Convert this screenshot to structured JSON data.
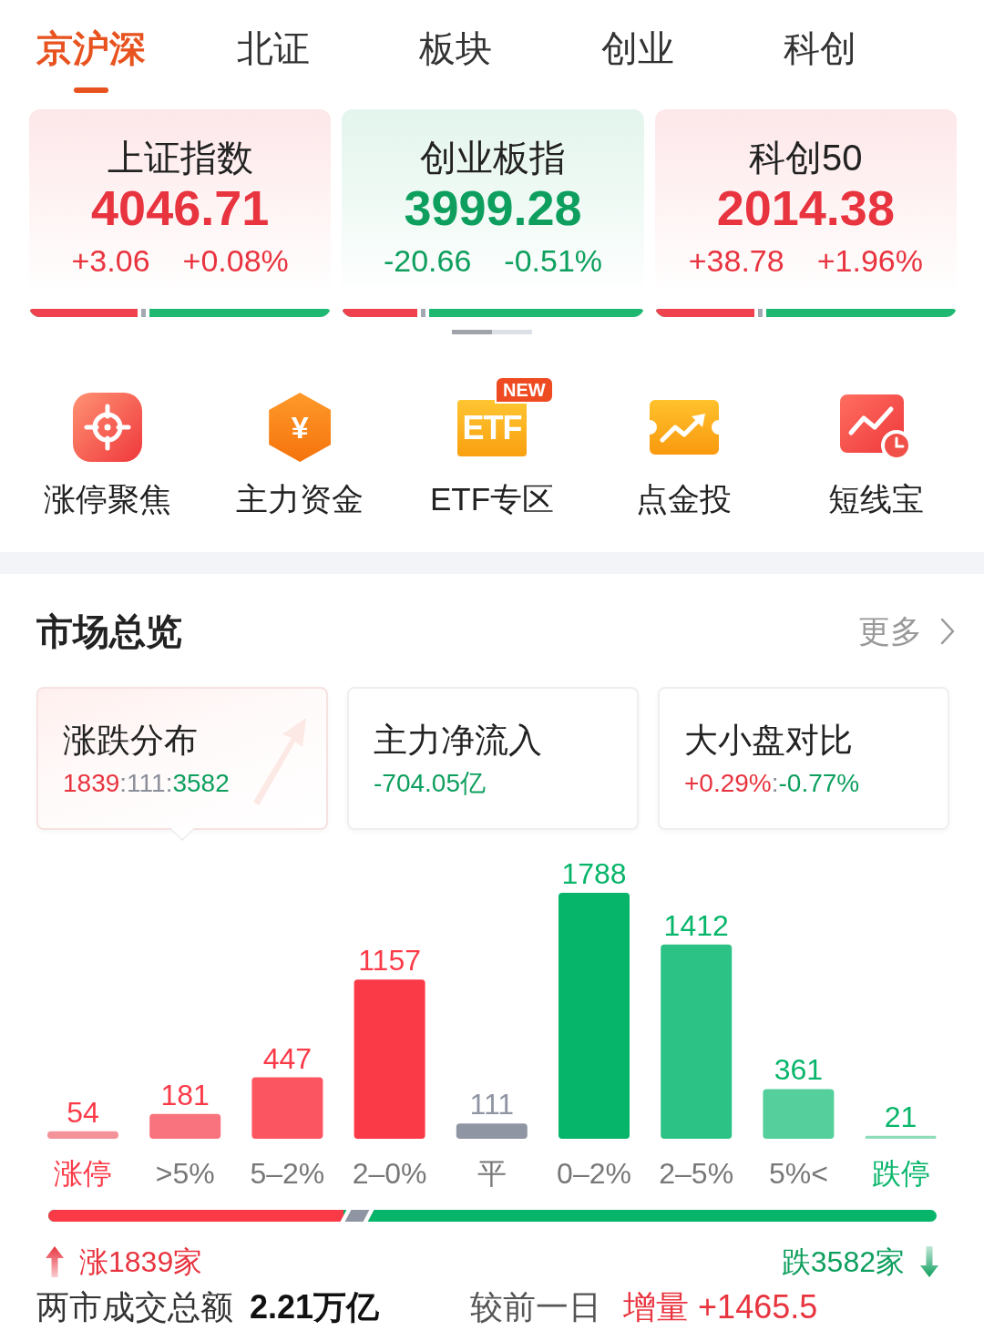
{
  "tabs": [
    {
      "label": "京沪深",
      "selected": true
    },
    {
      "label": "北证",
      "selected": false
    },
    {
      "label": "板块",
      "selected": false
    },
    {
      "label": "创业",
      "selected": false
    },
    {
      "label": "科创",
      "selected": false
    }
  ],
  "indices": [
    {
      "name": "上证指数",
      "value": "4046.71",
      "change": "+3.06",
      "percent": "+0.08%",
      "kind": "up",
      "breadth": {
        "level": 0.36
      }
    },
    {
      "name": "创业板指",
      "value": "3999.28",
      "change": "-20.66",
      "percent": "-0.51%",
      "kind": "down",
      "breadth": {
        "level": 0.25
      }
    },
    {
      "name": "科创50",
      "value": "2014.38",
      "change": "+38.78",
      "percent": "+1.96%",
      "kind": "up",
      "breadth": {
        "level": 0.33
      }
    }
  ],
  "pager": [
    {
      "selected": true
    },
    {
      "selected": false
    }
  ],
  "shortcuts": [
    {
      "kind": "target",
      "label": "涨停聚焦"
    },
    {
      "kind": "coin",
      "label": "主力资金",
      "icon_text": "¥"
    },
    {
      "kind": "tile",
      "label": "ETF专区",
      "icon_text": "ETF",
      "badge": "NEW"
    },
    {
      "kind": "ticket",
      "label": "点金投"
    },
    {
      "kind": "chart",
      "label": "短线宝"
    }
  ],
  "market_overview": {
    "title": "市场总览",
    "more": "更多",
    "cards": [
      {
        "title": "涨跌分布",
        "selected": true,
        "value_parts": [
          {
            "text": "1839",
            "kind": "up"
          },
          {
            "text": ":111:",
            "kind": "flat"
          },
          {
            "text": "3582",
            "kind": "down"
          }
        ]
      },
      {
        "title": "主力净流入",
        "selected": false,
        "value_parts": [
          {
            "text": "-704.05亿",
            "kind": "down"
          }
        ]
      },
      {
        "title": "大小盘对比",
        "selected": false,
        "value_parts": [
          {
            "text": "+0.29%",
            "kind": "up"
          },
          {
            "text": ":",
            "kind": "flat"
          },
          {
            "text": "-0.77%",
            "kind": "down"
          }
        ]
      }
    ],
    "distribution": {
      "chart_data": {
        "type": "bar",
        "categories": [
          "涨停",
          ">5%",
          "5–2%",
          "2–0%",
          "平",
          "0–2%",
          "2–5%",
          "5%<",
          "跌停"
        ],
        "series": [
          {
            "color": "#f4929a",
            "values": [
              54,
              null,
              null,
              null,
              null,
              null,
              null,
              null,
              null
            ]
          },
          {
            "color": "#f8737d",
            "values": [
              null,
              181,
              null,
              null,
              null,
              null,
              null,
              null,
              null
            ]
          },
          {
            "color": "#fc5562",
            "values": [
              null,
              null,
              447,
              null,
              null,
              null,
              null,
              null,
              null
            ]
          },
          {
            "color": "#fb3a48",
            "values": [
              null,
              null,
              null,
              1157,
              null,
              null,
              null,
              null,
              null
            ]
          },
          {
            "color": "#8f95a3",
            "values": [
              null,
              null,
              null,
              null,
              111,
              null,
              null,
              null,
              null
            ]
          },
          {
            "color": "#07b56a",
            "values": [
              null,
              null,
              null,
              null,
              null,
              1788,
              null,
              null,
              null
            ]
          },
          {
            "color": "#2cc286",
            "values": [
              null,
              null,
              null,
              null,
              null,
              null,
              1412,
              null,
              null
            ]
          },
          {
            "color": "#55cf9c",
            "values": [
              null,
              null,
              null,
              null,
              null,
              null,
              null,
              361,
              null
            ]
          },
          {
            "color": "#8fdcba",
            "values": [
              null,
              null,
              null,
              null,
              null,
              null,
              null,
              null,
              21
            ]
          }
        ],
        "data_labels": true
      },
      "counts": [
        {
          "text": "涨1839家",
          "kind": "up"
        },
        {
          "text": "跌3582家",
          "kind": "down"
        }
      ]
    },
    "turnover": {
      "label": "两市成交总额",
      "value": "2.21万亿",
      "compare_label": "较前一日",
      "change": "增量 +1465.5"
    }
  }
}
